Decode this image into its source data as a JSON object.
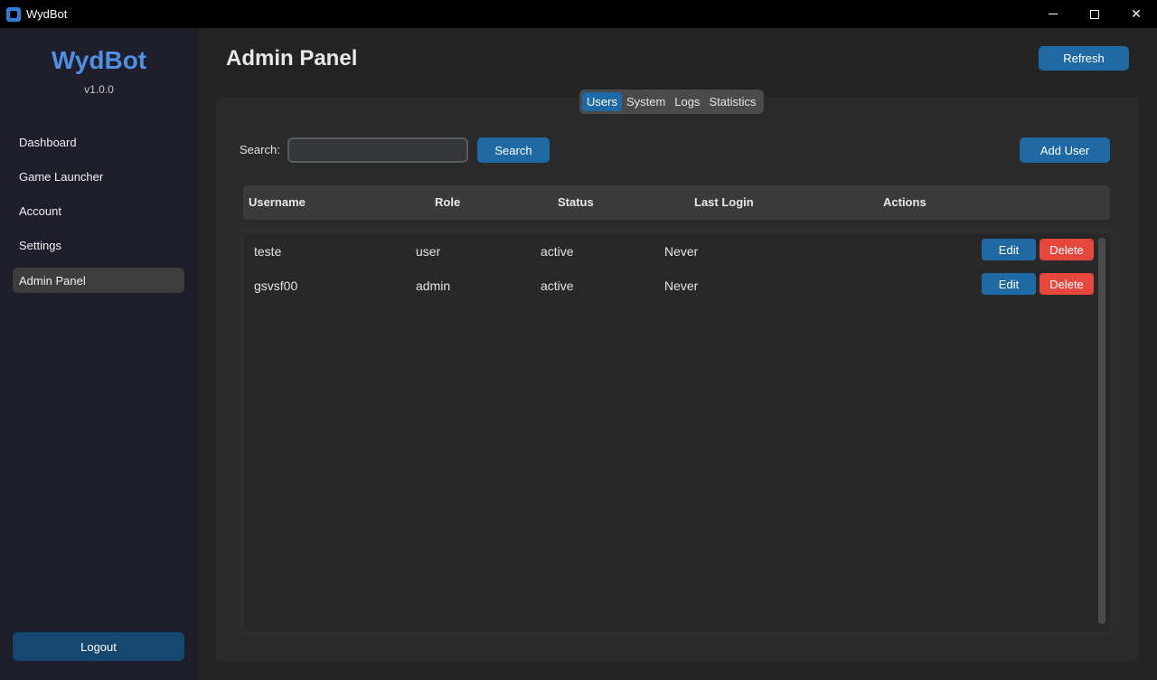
{
  "window": {
    "title": "WydBot",
    "icon": "wydbot-app-icon",
    "controls": [
      "minimize-icon",
      "maximize-icon",
      "close-icon"
    ],
    "close_glyph": "✕"
  },
  "sidebar": {
    "logo": "WydBot",
    "version": "v1.0.0",
    "items": [
      {
        "label": "Dashboard",
        "active": false
      },
      {
        "label": "Game Launcher",
        "active": false
      },
      {
        "label": "Account",
        "active": false
      },
      {
        "label": "Settings",
        "active": false
      },
      {
        "label": "Admin Panel",
        "active": true
      }
    ],
    "logout_label": "Logout"
  },
  "header": {
    "title": "Admin Panel",
    "refresh_label": "Refresh"
  },
  "tabs": [
    {
      "label": "Users",
      "active": true
    },
    {
      "label": "System",
      "active": false
    },
    {
      "label": "Logs",
      "active": false
    },
    {
      "label": "Statistics",
      "active": false
    }
  ],
  "search": {
    "label": "Search:",
    "value": "",
    "placeholder": "",
    "button_label": "Search"
  },
  "add_user_label": "Add User",
  "table": {
    "columns": [
      "Username",
      "Role",
      "Status",
      "Last Login",
      "Actions"
    ],
    "rows": [
      {
        "username": "teste",
        "role": "user",
        "status": "active",
        "last_login": "Never",
        "edit_label": "Edit",
        "delete_label": "Delete"
      },
      {
        "username": "gsvsf00",
        "role": "admin",
        "status": "active",
        "last_login": "Never",
        "edit_label": "Edit",
        "delete_label": "Delete"
      }
    ]
  },
  "colors": {
    "accent": "#1f6aa5",
    "danger": "#e5473d",
    "logo": "#4f8fe5",
    "sidebar_bg": "#1e1f2a",
    "main_bg": "#242424"
  }
}
